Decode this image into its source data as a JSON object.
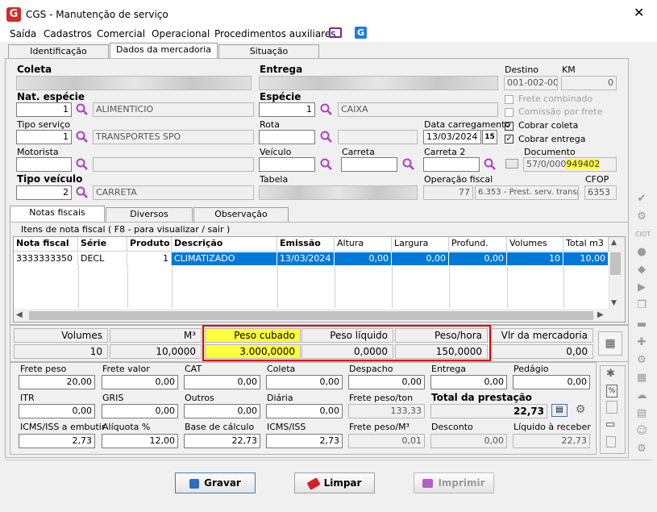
{
  "window": {
    "title": "CGS - Manutenção de serviço",
    "close": "✕"
  },
  "menu": [
    "Saída",
    "Cadastros",
    "Comercial",
    "Operacional",
    "Procedimentos auxiliares"
  ],
  "tabs": [
    "Identificação",
    "Dados da mercadoria",
    "Situação"
  ],
  "form": {
    "coleta_label": "Coleta",
    "entrega_label": "Entrega",
    "destino_label": "Destino",
    "destino_value": "001-002-002",
    "km_label": "KM",
    "km_value": "0",
    "nat_especie_label": "Nat. espécie",
    "nat_especie_code": "1",
    "nat_especie_desc": "ALIMENTICIO",
    "especie_label": "Espécie",
    "especie_code": "1",
    "especie_desc": "CAIXA",
    "frete_combinado": "Frete combinado",
    "comissao_frete": "Comissão por frete",
    "cobrar_coleta": "Cobrar coleta",
    "cobrar_entrega": "Cobrar entrega",
    "tipo_servico_label": "Tipo serviço",
    "tipo_servico_code": "1",
    "tipo_servico_desc": "TRANSPORTES SPO",
    "rota_label": "Rota",
    "data_carregamento_label": "Data carregamento",
    "data_carregamento_value": "13/03/2024",
    "cal_btn": "15",
    "motorista_label": "Motorista",
    "veiculo_label": "Veículo",
    "carreta_label": "Carreta",
    "carreta2_label": "Carreta 2",
    "documento_label": "Documento",
    "documento_prefix": "57/0/000",
    "documento_hl": "949402",
    "tipo_veiculo_label": "Tipo veículo",
    "tipo_veiculo_code": "2",
    "tipo_veiculo_desc": "CARRETA",
    "tabela_label": "Tabela",
    "operacao_label": "Operação fiscal",
    "operacao_code": "77",
    "operacao_desc": "6.353 - Prest. serv. transp.",
    "cfop_label": "CFOP",
    "cfop_value": "6353"
  },
  "subtabs": [
    "Notas fiscais",
    "Diversos",
    "Observação"
  ],
  "grid": {
    "group_title": "Itens de nota fiscal ( F8 - para visualizar / sair )",
    "headers": [
      "Nota fiscal",
      "Série",
      "Produto",
      "Descrição",
      "Emissão",
      "Altura",
      "Largura",
      "Profund.",
      "Volumes",
      "Total m3"
    ],
    "row": [
      "3333333350",
      "DECL",
      "1",
      "CLIMATIZADO",
      "13/03/2024",
      "0,00",
      "0,00",
      "0,00",
      "10",
      "10,00"
    ]
  },
  "summary": {
    "headers": [
      "Volumes",
      "M³",
      "Peso cubado",
      "Peso líquido",
      "Peso/hora",
      "Vlr da mercadoria"
    ],
    "values": [
      "10",
      "10,0000",
      "3.000,0000",
      "0,0000",
      "150,0000",
      "0,00"
    ]
  },
  "totals": {
    "row1": [
      [
        "Frete peso",
        "20,00"
      ],
      [
        "Frete valor",
        "0,00"
      ],
      [
        "CAT",
        "0,00"
      ],
      [
        "Coleta",
        "0,00"
      ],
      [
        "Despacho",
        "0,00"
      ],
      [
        "Entrega",
        "0,00"
      ],
      [
        "Pedágio",
        "0,00"
      ]
    ],
    "row2": [
      [
        "ITR",
        "0,00"
      ],
      [
        "GRIS",
        "0,00"
      ],
      [
        "Outros",
        "0,00"
      ],
      [
        "Diária",
        "0,00"
      ],
      [
        "Frete peso/ton",
        "133,33"
      ],
      [
        "Total da prestação",
        "22,73"
      ]
    ],
    "row3": [
      [
        "ICMS/ISS a embutir",
        "2,73"
      ],
      [
        "Alíquota %",
        "12,00"
      ],
      [
        "Base de cálculo",
        "22,73"
      ],
      [
        "ICMS/ISS",
        "2,73"
      ],
      [
        "Frete peso/M³",
        "0,01"
      ],
      [
        "Desconto",
        "0,00"
      ],
      [
        "Líquido à receber",
        "22,73"
      ]
    ]
  },
  "buttons": {
    "gravar": "Gravar",
    "limpar": "Limpar",
    "imprimir": "Imprimir"
  },
  "colors": {
    "accent": "#0078d7",
    "highlight": "#ffff3c",
    "redbox": "#e00000",
    "search": "#b040c0"
  }
}
